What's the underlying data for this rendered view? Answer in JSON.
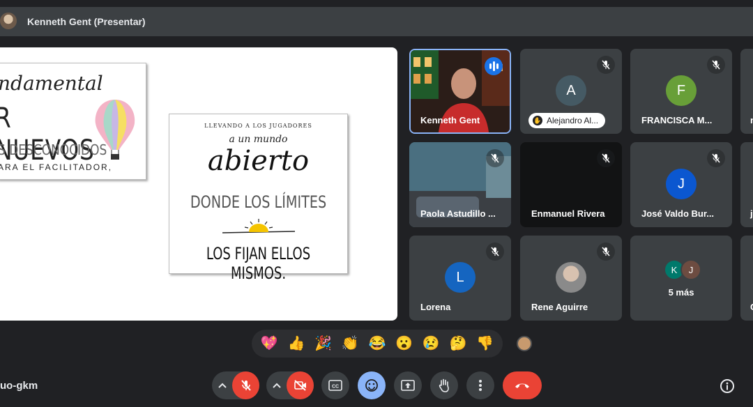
{
  "topbar": {
    "title": "Kenneth Gent (Presentar)"
  },
  "slide": {
    "card1": {
      "line1": "ndamental",
      "line2": "R NUEVOS",
      "line3": "S DESCONOCIDOS",
      "line4": "ARA EL FACILITADOR,"
    },
    "card2": {
      "line1": "LLEVANDO A LOS JUGADORES",
      "line2": "a un mundo",
      "line3": "abierto",
      "line4": "DONDE LOS LÍMITES",
      "line5": "LOS FIJAN ELLOS MISMOS."
    }
  },
  "participants": [
    {
      "name": "Kenneth Gent",
      "type": "video",
      "speaking": true
    },
    {
      "name": "Alejandro Al...",
      "initial": "A",
      "color": "#455a64",
      "type": "hand"
    },
    {
      "name": "FRANCISCA M...",
      "initial": "F",
      "color": "#689f38",
      "type": "avatar"
    },
    {
      "name": "Paola Astudillo ...",
      "type": "video"
    },
    {
      "name": "Enmanuel Rivera",
      "type": "video"
    },
    {
      "name": "José Valdo Bur...",
      "initial": "J",
      "color": "#0b57d0",
      "type": "avatar"
    },
    {
      "name": "Lorena",
      "initial": "L",
      "color": "#1565c0",
      "type": "avatar"
    },
    {
      "name": "Rene Aguirre",
      "type": "photo"
    },
    {
      "name": "5 más",
      "type": "more",
      "initials": [
        "K",
        "J"
      ],
      "colors": [
        "#00796b",
        "#6d4c41"
      ]
    }
  ],
  "edge_labels": [
    "n",
    "j",
    "C"
  ],
  "reactions": [
    "💖",
    "👍",
    "🎉",
    "👏",
    "😂",
    "😮",
    "😢",
    "🤔",
    "👎"
  ],
  "meeting_code": "uo-gkm",
  "icons": {
    "mic": "mic-off-icon",
    "cam": "camera-off-icon",
    "cc": "captions-icon",
    "emoji": "emoji-icon",
    "present": "present-icon",
    "hand": "raise-hand-icon",
    "more": "more-vert-icon",
    "end": "end-call-icon",
    "info": "info-icon"
  }
}
